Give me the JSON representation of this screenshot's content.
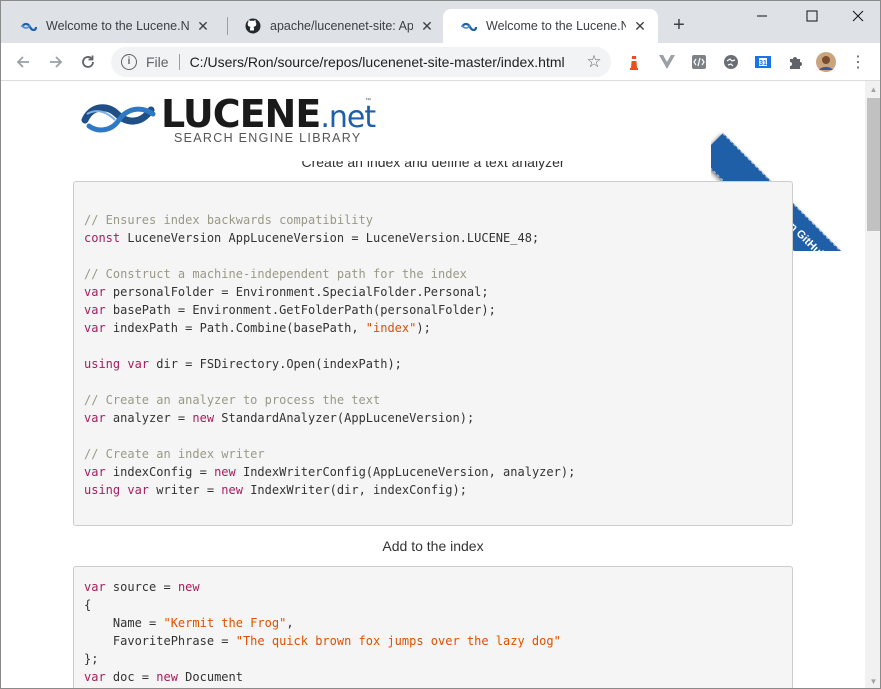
{
  "tabs": [
    {
      "title": "Welcome to the Lucene.Net",
      "favicon": "lucene-favicon-icon",
      "active": false
    },
    {
      "title": "apache/lucenenet-site: Apac",
      "favicon": "github-icon",
      "active": false
    },
    {
      "title": "Welcome to the Lucene.Net",
      "favicon": "lucene-favicon-icon",
      "active": true
    }
  ],
  "toolbar": {
    "scheme": "File",
    "url": "C:/Users/Ron/source/repos/lucenenet-site-master/index.html"
  },
  "page": {
    "logo_word": "LUCENE",
    "logo_suffix": ".net",
    "logo_tm": "™",
    "logo_tagline": "SEARCH ENGINE LIBRARY",
    "ribbon_text": "Fork me on GitHub",
    "section1_caption": "Create an index and define a text analyzer",
    "section2_caption": "Add to the index"
  },
  "code1": [
    [],
    [
      {
        "t": "// Ensures index backwards compatibility",
        "c": "com"
      }
    ],
    [
      {
        "t": "const",
        "c": "kw"
      },
      {
        "t": " LuceneVersion AppLuceneVersion = LuceneVersion.LUCENE_48;",
        "c": "plain"
      }
    ],
    [],
    [
      {
        "t": "// Construct a machine-independent path for the index",
        "c": "com"
      }
    ],
    [
      {
        "t": "var",
        "c": "kw"
      },
      {
        "t": " personalFolder = Environment.SpecialFolder.Personal;",
        "c": "plain"
      }
    ],
    [
      {
        "t": "var",
        "c": "kw"
      },
      {
        "t": " basePath = Environment.GetFolderPath(personalFolder);",
        "c": "plain"
      }
    ],
    [
      {
        "t": "var",
        "c": "kw"
      },
      {
        "t": " indexPath = Path.Combine(basePath, ",
        "c": "plain"
      },
      {
        "t": "\"index\"",
        "c": "str"
      },
      {
        "t": ");",
        "c": "plain"
      }
    ],
    [],
    [
      {
        "t": "using",
        "c": "kw"
      },
      {
        "t": " ",
        "c": "plain"
      },
      {
        "t": "var",
        "c": "kw"
      },
      {
        "t": " dir = FSDirectory.Open(indexPath);",
        "c": "plain"
      }
    ],
    [],
    [
      {
        "t": "// Create an analyzer to process the text",
        "c": "com"
      }
    ],
    [
      {
        "t": "var",
        "c": "kw"
      },
      {
        "t": " analyzer = ",
        "c": "plain"
      },
      {
        "t": "new",
        "c": "kw"
      },
      {
        "t": " StandardAnalyzer(AppLuceneVersion);",
        "c": "plain"
      }
    ],
    [],
    [
      {
        "t": "// Create an index writer",
        "c": "com"
      }
    ],
    [
      {
        "t": "var",
        "c": "kw"
      },
      {
        "t": " indexConfig = ",
        "c": "plain"
      },
      {
        "t": "new",
        "c": "kw"
      },
      {
        "t": " IndexWriterConfig(AppLuceneVersion, analyzer);",
        "c": "plain"
      }
    ],
    [
      {
        "t": "using",
        "c": "kw"
      },
      {
        "t": " ",
        "c": "plain"
      },
      {
        "t": "var",
        "c": "kw"
      },
      {
        "t": " writer = ",
        "c": "plain"
      },
      {
        "t": "new",
        "c": "kw"
      },
      {
        "t": " IndexWriter(dir, indexConfig);",
        "c": "plain"
      }
    ],
    []
  ],
  "code2": [
    [
      {
        "t": "var",
        "c": "kw"
      },
      {
        "t": " source = ",
        "c": "plain"
      },
      {
        "t": "new",
        "c": "kw"
      }
    ],
    [
      {
        "t": "{",
        "c": "plain"
      }
    ],
    [
      {
        "t": "    Name = ",
        "c": "plain"
      },
      {
        "t": "\"Kermit the Frog\"",
        "c": "str"
      },
      {
        "t": ",",
        "c": "plain"
      }
    ],
    [
      {
        "t": "    FavoritePhrase = ",
        "c": "plain"
      },
      {
        "t": "\"The quick brown fox jumps over the lazy dog\"",
        "c": "str"
      }
    ],
    [
      {
        "t": "};",
        "c": "plain"
      }
    ],
    [
      {
        "t": "var",
        "c": "kw"
      },
      {
        "t": " doc = ",
        "c": "plain"
      },
      {
        "t": "new",
        "c": "kw"
      },
      {
        "t": " Document",
        "c": "plain"
      }
    ]
  ],
  "colors": {
    "accent": "#1f5fa8",
    "keyword": "#a71d5d",
    "string": "#df5000",
    "comment": "#999988"
  }
}
